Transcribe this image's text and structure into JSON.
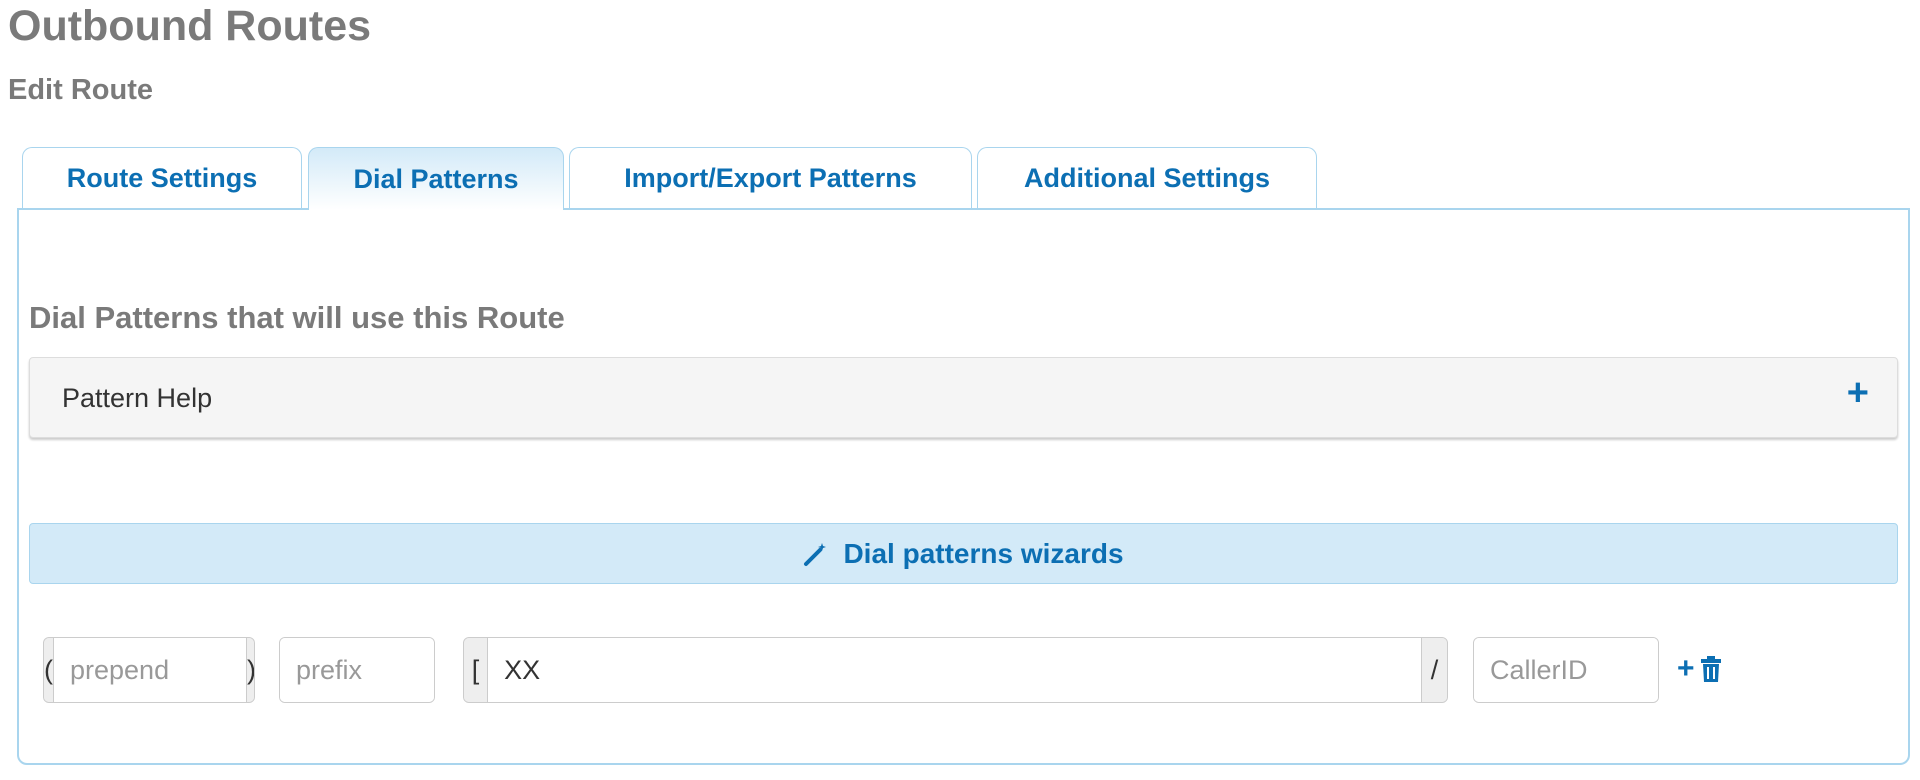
{
  "header": {
    "title": "Outbound Routes",
    "subtitle": "Edit Route"
  },
  "tabs": [
    {
      "label": "Route Settings"
    },
    {
      "label": "Dial Patterns",
      "active": true
    },
    {
      "label": "Import/Export Patterns"
    },
    {
      "label": "Additional Settings"
    }
  ],
  "section": {
    "title": "Dial Patterns that will use this Route"
  },
  "pattern_help": {
    "label": "Pattern Help",
    "icon": "plus-icon",
    "toggle": "+"
  },
  "wizard": {
    "label": "Dial patterns wizards",
    "icon": "magic-wand-icon"
  },
  "pattern_row": {
    "open_paren": "(",
    "prepend_placeholder": "prepend",
    "close_paren": ")",
    "prefix_placeholder": "prefix",
    "pipe": "|",
    "open_bracket": "[",
    "match_value": "XX",
    "slash": "/",
    "callerid_placeholder": "CallerID",
    "close_bracket": "]",
    "add_glyph": "+",
    "delete_glyph": "🗑"
  },
  "colors": {
    "accent": "#0c6fb3",
    "tab_border": "#a9d5ee",
    "wizard_bg": "#d3eaf8",
    "heading": "#7a7a7a"
  }
}
